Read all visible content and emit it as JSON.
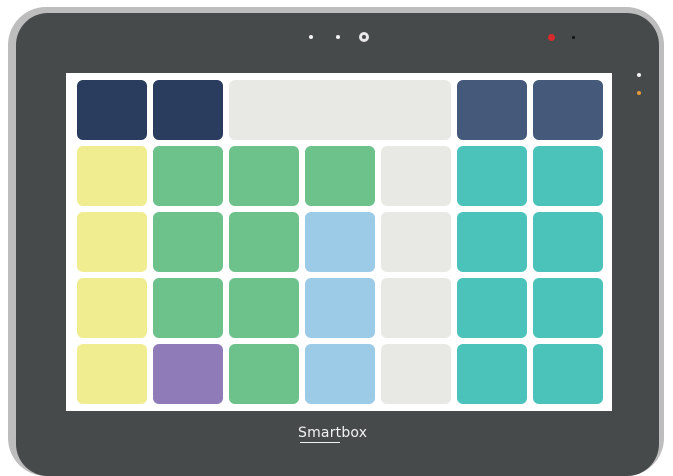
{
  "device": {
    "brand": "Smartbox",
    "colors": {
      "outer_frame": "#bdbdbd",
      "bezel": "#474a4b",
      "screen": "#ffffff",
      "indicator_red": "#d72b2b",
      "indicator_orange": "#e69a3a"
    }
  },
  "grid": {
    "rows": 5,
    "columns": 7,
    "palette": {
      "navy": "#2a3d5e",
      "slate_blue": "#455a7a",
      "light_gray": "#e8e8e4",
      "yellow": "#f0ec90",
      "green": "#6cc28a",
      "teal": "#4bc2ba",
      "light_blue": "#9ccbe7",
      "purple": "#8f7bb8"
    },
    "cells": [
      {
        "row": 0,
        "col": 0,
        "span": 1,
        "color": "navy"
      },
      {
        "row": 0,
        "col": 1,
        "span": 1,
        "color": "navy"
      },
      {
        "row": 0,
        "col": 2,
        "span": 3,
        "color": "light_gray"
      },
      {
        "row": 0,
        "col": 5,
        "span": 1,
        "color": "slate_blue"
      },
      {
        "row": 0,
        "col": 6,
        "span": 1,
        "color": "slate_blue"
      },
      {
        "row": 1,
        "col": 0,
        "span": 1,
        "color": "yellow"
      },
      {
        "row": 1,
        "col": 1,
        "span": 1,
        "color": "green"
      },
      {
        "row": 1,
        "col": 2,
        "span": 1,
        "color": "green"
      },
      {
        "row": 1,
        "col": 3,
        "span": 1,
        "color": "green"
      },
      {
        "row": 1,
        "col": 4,
        "span": 1,
        "color": "light_gray"
      },
      {
        "row": 1,
        "col": 5,
        "span": 1,
        "color": "teal"
      },
      {
        "row": 1,
        "col": 6,
        "span": 1,
        "color": "teal"
      },
      {
        "row": 2,
        "col": 0,
        "span": 1,
        "color": "yellow"
      },
      {
        "row": 2,
        "col": 1,
        "span": 1,
        "color": "green"
      },
      {
        "row": 2,
        "col": 2,
        "span": 1,
        "color": "green"
      },
      {
        "row": 2,
        "col": 3,
        "span": 1,
        "color": "light_blue"
      },
      {
        "row": 2,
        "col": 4,
        "span": 1,
        "color": "light_gray"
      },
      {
        "row": 2,
        "col": 5,
        "span": 1,
        "color": "teal"
      },
      {
        "row": 2,
        "col": 6,
        "span": 1,
        "color": "teal"
      },
      {
        "row": 3,
        "col": 0,
        "span": 1,
        "color": "yellow"
      },
      {
        "row": 3,
        "col": 1,
        "span": 1,
        "color": "green"
      },
      {
        "row": 3,
        "col": 2,
        "span": 1,
        "color": "green"
      },
      {
        "row": 3,
        "col": 3,
        "span": 1,
        "color": "light_blue"
      },
      {
        "row": 3,
        "col": 4,
        "span": 1,
        "color": "light_gray"
      },
      {
        "row": 3,
        "col": 5,
        "span": 1,
        "color": "teal"
      },
      {
        "row": 3,
        "col": 6,
        "span": 1,
        "color": "teal"
      },
      {
        "row": 4,
        "col": 0,
        "span": 1,
        "color": "yellow"
      },
      {
        "row": 4,
        "col": 1,
        "span": 1,
        "color": "purple"
      },
      {
        "row": 4,
        "col": 2,
        "span": 1,
        "color": "green"
      },
      {
        "row": 4,
        "col": 3,
        "span": 1,
        "color": "light_blue"
      },
      {
        "row": 4,
        "col": 4,
        "span": 1,
        "color": "light_gray"
      },
      {
        "row": 4,
        "col": 5,
        "span": 1,
        "color": "teal"
      },
      {
        "row": 4,
        "col": 6,
        "span": 1,
        "color": "teal"
      }
    ]
  }
}
